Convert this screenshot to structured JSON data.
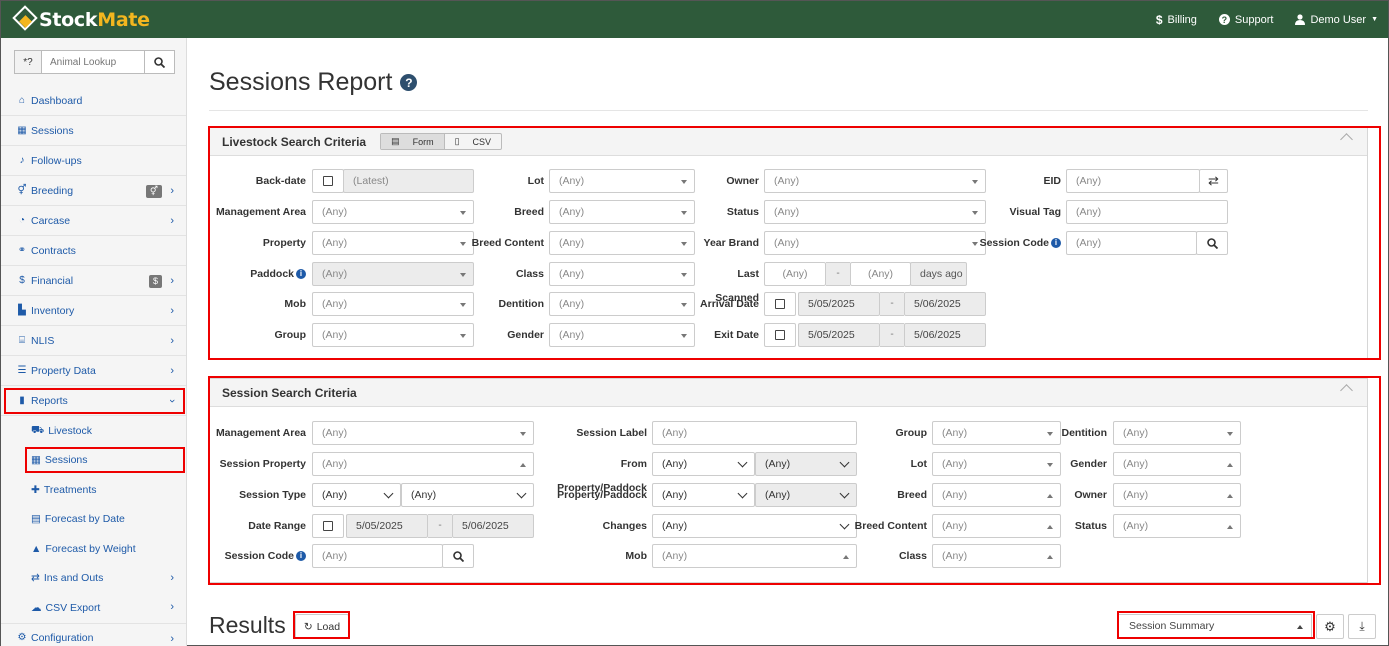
{
  "app": {
    "logo_stock": "Stock",
    "logo_mate": "Mate"
  },
  "topnav": {
    "billing": "Billing",
    "support": "Support",
    "user": "Demo User"
  },
  "lookup": {
    "prefix": "*?",
    "placeholder": "Animal Lookup"
  },
  "sidebar": {
    "items": [
      {
        "label": "Dashboard",
        "icon": "home-icon"
      },
      {
        "label": "Sessions",
        "icon": "table-icon"
      },
      {
        "label": "Follow-ups",
        "icon": "bell-icon"
      },
      {
        "label": "Breeding",
        "icon": "gender-icon",
        "badge": "⚥"
      },
      {
        "label": "Carcase",
        "icon": "pie-icon"
      },
      {
        "label": "Contracts",
        "icon": "handshake-icon"
      },
      {
        "label": "Financial",
        "icon": "dollar-icon",
        "badge": "$"
      },
      {
        "label": "Inventory",
        "icon": "boxes-icon"
      },
      {
        "label": "NLIS",
        "icon": "building-icon"
      },
      {
        "label": "Property Data",
        "icon": "sliders-icon"
      },
      {
        "label": "Reports",
        "icon": "bar-chart-icon"
      }
    ],
    "reports_sub": [
      {
        "label": "Livestock"
      },
      {
        "label": "Sessions"
      },
      {
        "label": "Treatments"
      },
      {
        "label": "Forecast by Date"
      },
      {
        "label": "Forecast by Weight"
      },
      {
        "label": "Ins and Outs"
      },
      {
        "label": "CSV Export"
      }
    ],
    "configuration": "Configuration"
  },
  "page": {
    "title": "Sessions Report"
  },
  "livestock": {
    "title": "Livestock Search Criteria",
    "toggle_form": "Form",
    "toggle_csv": "CSV",
    "labels": {
      "back_date": "Back-date",
      "management_area": "Management Area",
      "property": "Property",
      "paddock": "Paddock",
      "mob": "Mob",
      "group": "Group",
      "lot": "Lot",
      "breed": "Breed",
      "breed_content": "Breed Content",
      "class": "Class",
      "dentition": "Dentition",
      "gender": "Gender",
      "owner": "Owner",
      "status": "Status",
      "year_brand": "Year Brand",
      "last_scanned": "Last Scanned",
      "arrival_date": "Arrival Date",
      "exit_date": "Exit Date",
      "eid": "EID",
      "visual_tag": "Visual Tag",
      "session_code": "Session Code"
    },
    "latest": "(Latest)",
    "any": "(Any)",
    "dash": "-",
    "days_ago": "days ago",
    "arrival_from": "5/05/2025",
    "arrival_to": "5/06/2025",
    "exit_from": "5/05/2025",
    "exit_to": "5/06/2025"
  },
  "session": {
    "title": "Session Search Criteria",
    "labels": {
      "management_area": "Management Area",
      "session_property": "Session Property",
      "session_type": "Session Type",
      "date_range": "Date Range",
      "session_code": "Session Code",
      "session_label": "Session Label",
      "from_property_paddock": "From Property/Paddock",
      "property_paddock": "Property/Paddock",
      "changes": "Changes",
      "mob": "Mob",
      "group": "Group",
      "lot": "Lot",
      "breed": "Breed",
      "breed_content": "Breed Content",
      "class": "Class",
      "dentition": "Dentition",
      "gender": "Gender",
      "owner": "Owner",
      "status": "Status"
    },
    "any": "(Any)",
    "date_from": "5/05/2025",
    "date_to": "5/06/2025",
    "dash": "-"
  },
  "results": {
    "title": "Results",
    "load": "Load",
    "view_select": "Session Summary"
  },
  "colors": {
    "topbar": "#2e5a3a",
    "accent": "#f3b61f",
    "link": "#1e5aa8",
    "highlight": "#e00000"
  }
}
